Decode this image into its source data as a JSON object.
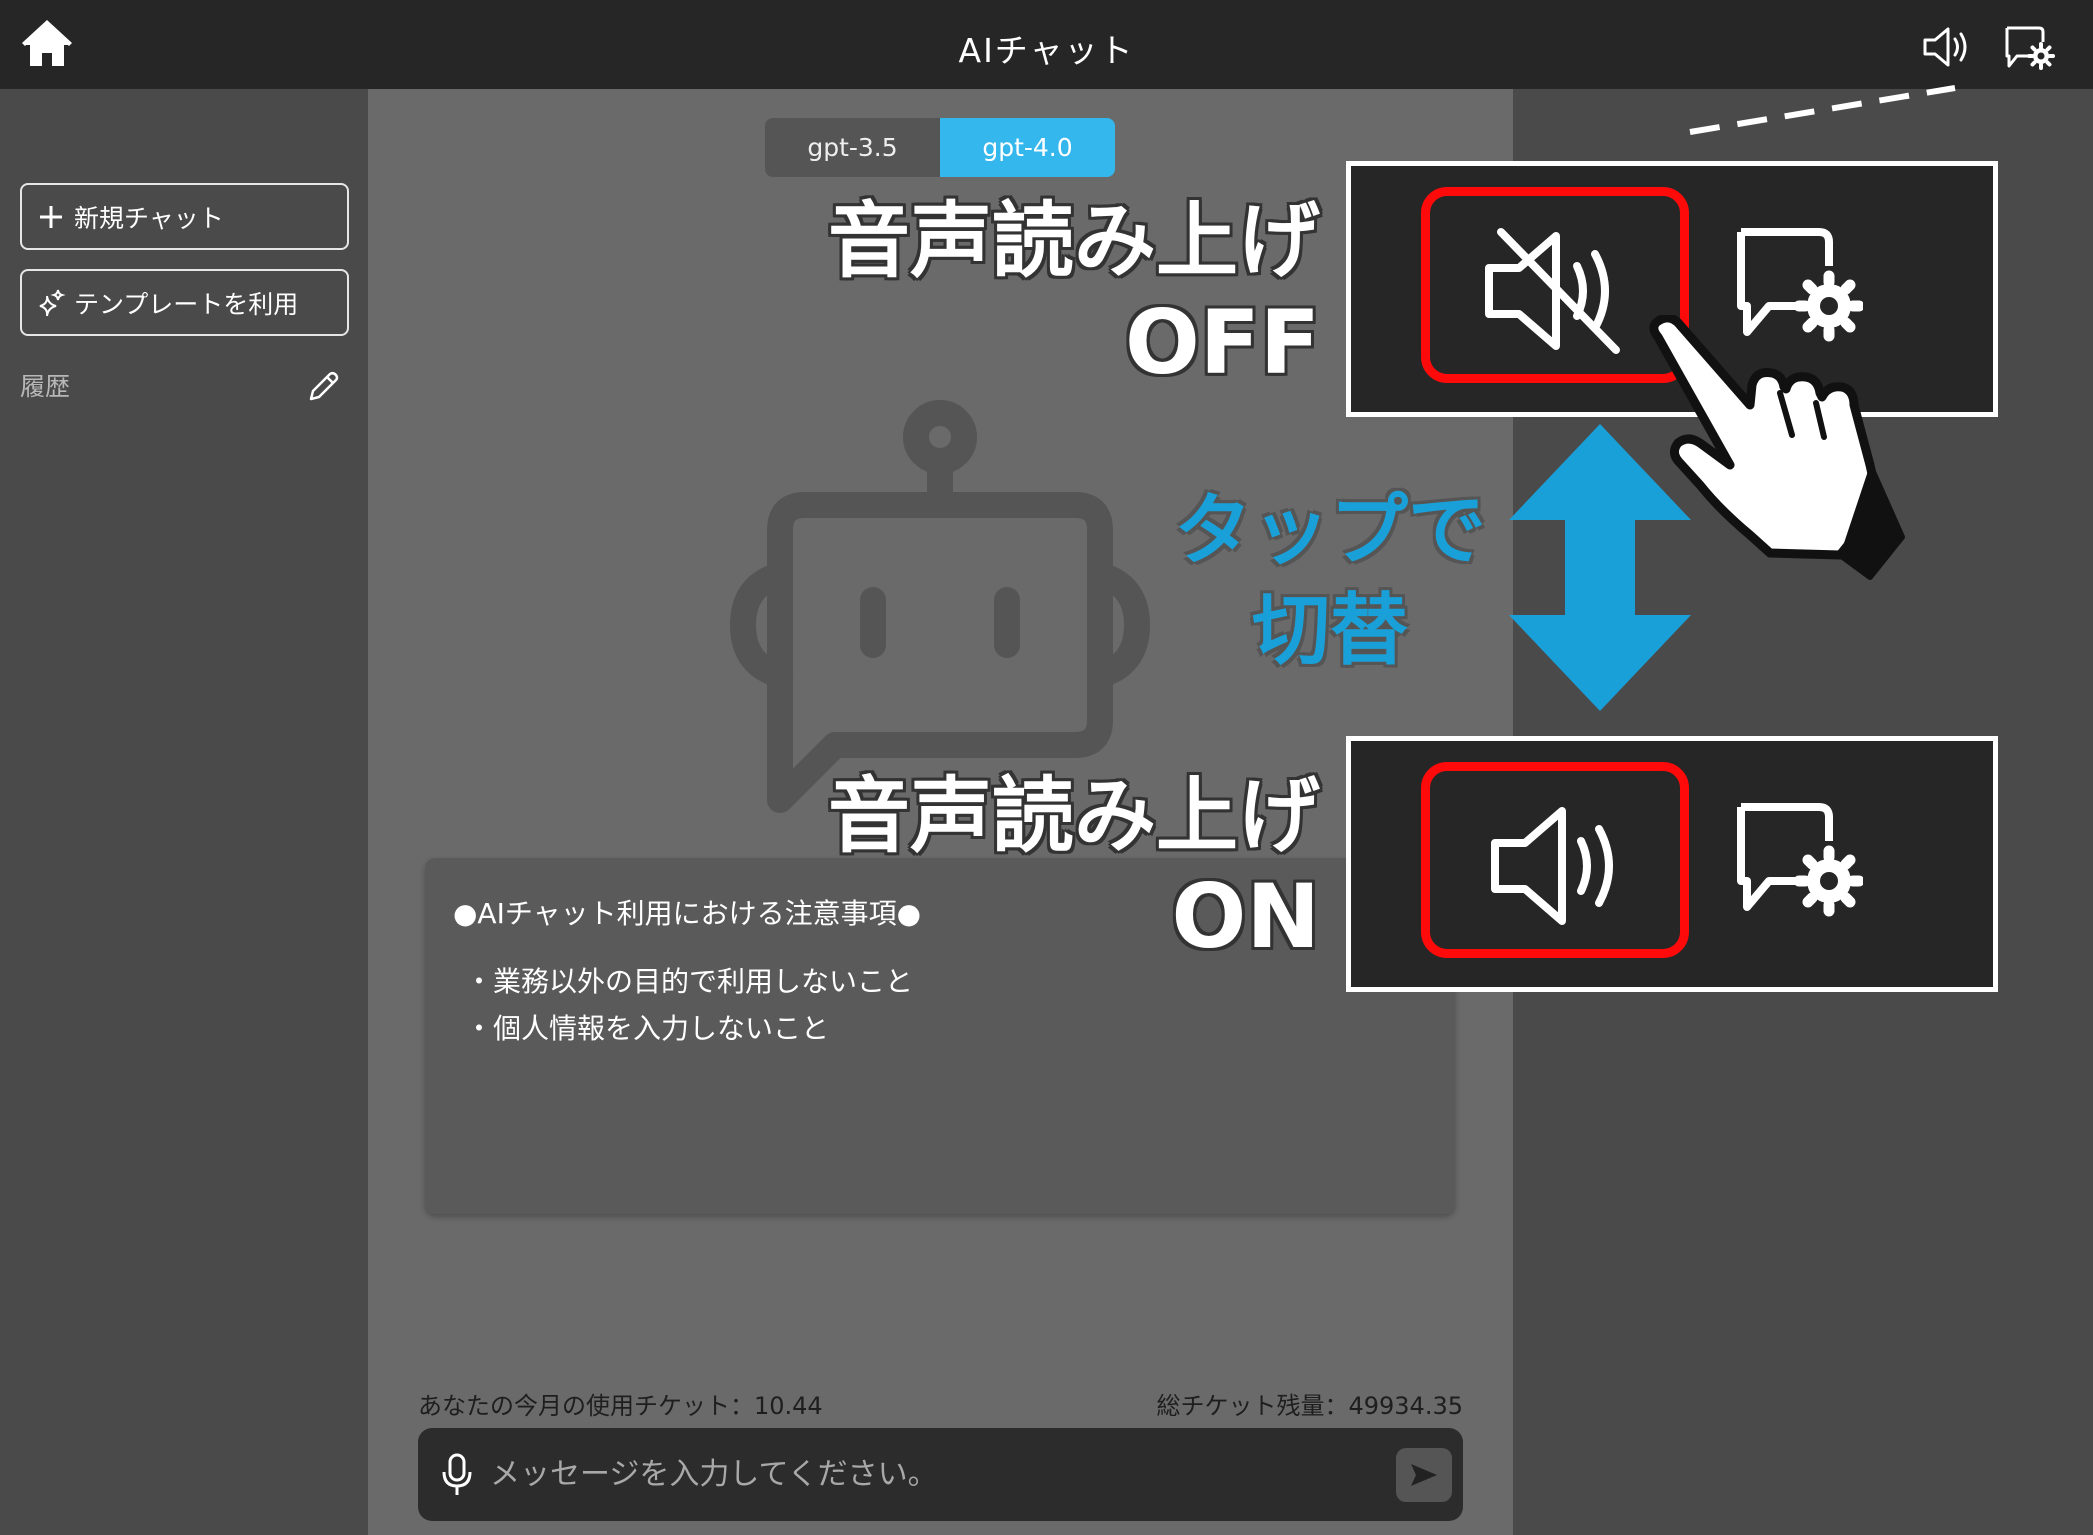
{
  "header": {
    "title": "AIチャット",
    "home_icon": "home-icon",
    "speaker_icon": "speaker-muted-icon",
    "settings_icon": "chat-settings-icon"
  },
  "sidebar": {
    "new_chat_label": "新規チャット",
    "template_label": "テンプレートを利用",
    "history_label": "履歴"
  },
  "model_selector": {
    "options": [
      "gpt-3.5",
      "gpt-4.0"
    ],
    "selected": "gpt-4.0",
    "accent_color": "#34b7ec"
  },
  "notice": {
    "title": "●AIチャット利用における注意事項●",
    "items": [
      "・業務以外の目的で利用しないこと",
      "・個人情報を入力しないこと"
    ]
  },
  "tickets": {
    "monthly_usage": "あなたの今月の使用チケット：10.44",
    "total_remaining": "総チケット残量：49934.35"
  },
  "message_input": {
    "placeholder": "メッセージを入力してください。"
  },
  "annotation": {
    "off_label_line1": "音声読み上げ",
    "off_label_line2": "OFF",
    "on_label_line1": "音声読み上げ",
    "on_label_line2": "ON",
    "tap_label_line1": "タップで",
    "tap_label_line2": "切替",
    "highlight_color": "#ff0a0a",
    "arrow_color": "#1aa0d8"
  }
}
